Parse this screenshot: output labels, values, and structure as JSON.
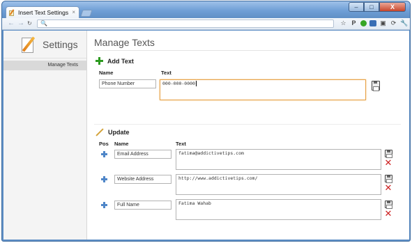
{
  "browser": {
    "tab_title": "Insert Text Settings",
    "tab_close": "×",
    "window_controls": {
      "minimize": "–",
      "maximize": "□",
      "close": "X"
    },
    "nav": {
      "back": "←",
      "forward": "→",
      "search_glyph": "🔍"
    },
    "toolbar_icons": [
      "star-icon",
      "p-extension-icon",
      "green-dot-icon",
      "cookie-icon",
      "puzzle-icon",
      "refresh-extension-icon",
      "wrench-icon"
    ]
  },
  "sidebar": {
    "title": "Settings",
    "items": [
      {
        "label": "Manage Texts",
        "selected": true
      }
    ]
  },
  "main": {
    "title": "Manage Texts",
    "add": {
      "heading": "Add Text",
      "name_label": "Name",
      "text_label": "Text",
      "name_value": "Phone Number",
      "text_value": "000-000-0000"
    },
    "update": {
      "heading": "Update",
      "pos_label": "Pos",
      "name_label": "Name",
      "text_label": "Text",
      "rows": [
        {
          "name": "Email Address",
          "text": "fatima@addictivetips.com"
        },
        {
          "name": "Website Address",
          "text": "http://www.addictivetips.com/"
        },
        {
          "name": "Full Name",
          "text": "Fatima Wahab"
        }
      ]
    }
  }
}
